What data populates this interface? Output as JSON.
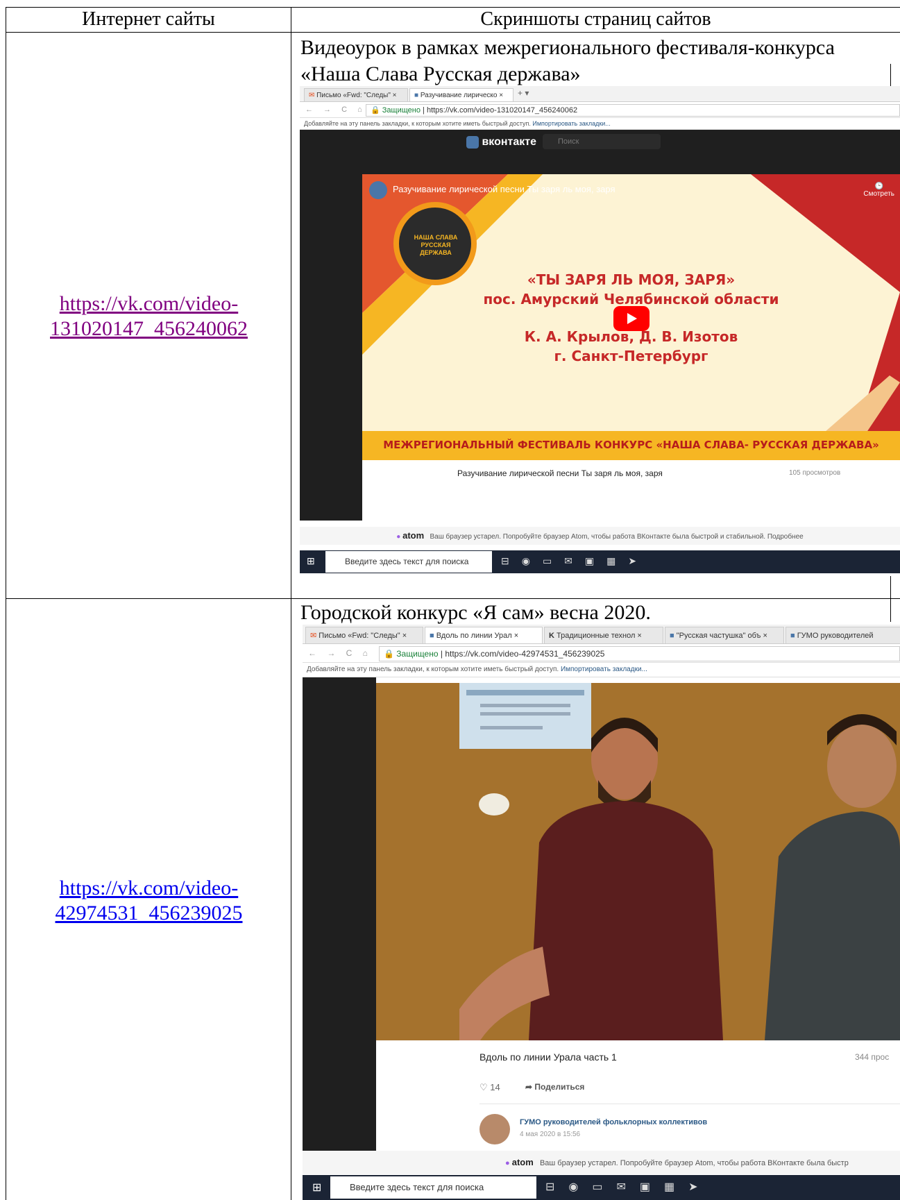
{
  "table": {
    "header_col1": "Интернет сайты",
    "header_col2": "Скриншоты страниц сайтов"
  },
  "rows": [
    {
      "link_line1": "https://vk.com/video-",
      "link_line2": "131020147_456240062",
      "caption_line1": "Видеоурок в рамках межрегионального фестиваля-конкурса",
      "caption_line2": "«Наша Слава Русская держава»",
      "tabs": [
        "Письмо «Fwd: \"Следы\"",
        "Разучивание лирическо"
      ],
      "secure_label": "Защищено",
      "url": "https://vk.com/video-131020147_456240062",
      "bookmarks_text": "Добавляйте на эту панель закладки, к которым хотите иметь быстрый доступ.",
      "bookmarks_link": "Импортировать закладки...",
      "vk_logo": "вконтакте",
      "vk_search": "Поиск",
      "video_title_overlay": "Разучивание лирической песни Ты заря ль моя, заря",
      "watch_later": "Смотреть",
      "poster_line1": "«ТЫ ЗАРЯ ЛЬ МОЯ, ЗАРЯ»",
      "poster_line2": "пос. Амурский Челябинской области",
      "poster_line3": "К. А. Крылов, Д. В. Изотов",
      "poster_line4": "г. Санкт-Петербург",
      "poster_banner": "МЕЖРЕГИОНАЛЬНЫЙ ФЕСТИВАЛЬ КОНКУРС «НАША СЛАВА- РУССКАЯ ДЕРЖАВА»",
      "emblem_text": "НАША СЛАВА РУССКАЯ ДЕРЖАВА",
      "video_title": "Разучивание лирической песни Ты заря ль моя, заря",
      "views": "105 просмотров",
      "atom_logo": "atom",
      "atom_msg": "Ваш браузер устарел. Попробуйте браузер Atom, чтобы работа ВКонтакте была быстрой и стабильной. Подробнее",
      "taskbar_search": "Введите здесь текст для поиска"
    },
    {
      "link_line1": "https://vk.com/video-",
      "link_line2": "42974531_456239025",
      "caption_line1": "Городской конкурс «Я сам» весна 2020.",
      "tabs": [
        "Письмо «Fwd: \"Следы\"",
        "Вдоль по линии Урал",
        "Традиционные технол",
        "\"Русская частушка\" объ",
        "ГУМО руководителей"
      ],
      "secure_label": "Защищено",
      "url": "https://vk.com/video-42974531_456239025",
      "bookmarks_text": "Добавляйте на эту панель закладки, к которым хотите иметь быстрый доступ.",
      "bookmarks_link": "Импортировать закладки...",
      "video_title": "Вдоль по линии Урала часть 1",
      "views": "344 прос",
      "likes": "14",
      "share": "Поделиться",
      "author": "ГУМО руководителей фольклорных коллективов",
      "date": "4 мая 2020 в 15:56",
      "atom_logo": "atom",
      "atom_msg": "Ваш браузер устарел. Попробуйте браузер Atom, чтобы работа ВКонтакте была быстр",
      "taskbar_search": "Введите здесь текст для поиска"
    }
  ],
  "colors": {
    "link_visited": "#800080",
    "link_unvisited": "#0000ee",
    "vk_blue": "#4a76a8",
    "poster_red": "#c62828",
    "poster_cream": "#fdf3d4",
    "banner_yellow": "#f6b623",
    "taskbar": "#1b2435"
  }
}
